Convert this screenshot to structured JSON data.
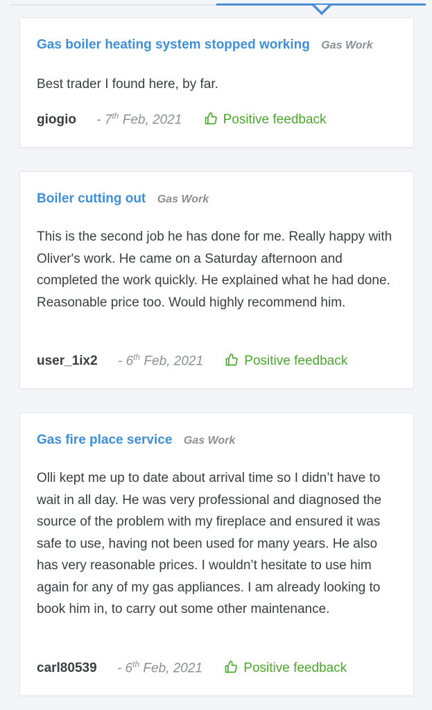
{
  "reviews": [
    {
      "title": "Gas boiler heating system stopped working",
      "category": "Gas Work",
      "text": "Best trader I found here, by far.",
      "user": "giogio",
      "date_prefix": "- 7",
      "date_sup": "th",
      "date_suffix": " Feb, 2021",
      "feedback": "Positive feedback"
    },
    {
      "title": "Boiler cutting out",
      "category": "Gas Work",
      "text": "This is the second job he has done for me. Really happy with Oliver's work. He came on a Saturday afternoon and completed the work quickly. He explained what he had done. Reasonable price too. Would highly recommend him.",
      "user": "user_1ix2",
      "date_prefix": "- 6",
      "date_sup": "th",
      "date_suffix": " Feb, 2021",
      "feedback": "Positive feedback"
    },
    {
      "title": "Gas fire place service",
      "category": "Gas Work",
      "text": "Olli kept me up to date about arrival time so I didn’t have to wait in all day. He was very professional and diagnosed the source of the problem with my fireplace and ensured it was safe to use, having not been used for many years. He also has very reasonable prices. I wouldn’t hesitate to use him again for any of my gas appliances. I am already looking to book him in, to carry out some other maintenance.",
      "user": "carl80539",
      "date_prefix": "- 6",
      "date_sup": "th",
      "date_suffix": " Feb, 2021",
      "feedback": "Positive feedback"
    }
  ],
  "colors": {
    "title": "#3f8fd6",
    "feedback": "#4ba82e",
    "tab_active": "#4a8fd4"
  },
  "icons": {
    "feedback": "thumbs-up-icon"
  }
}
